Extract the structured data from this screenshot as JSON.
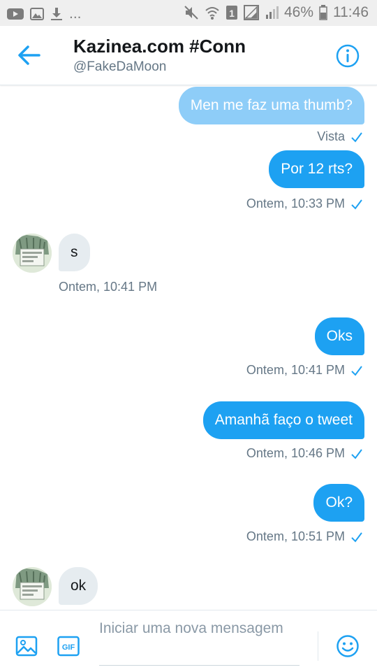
{
  "status_bar": {
    "left_more": "...",
    "battery_percent": "46%",
    "time": "11:46",
    "sim_slot": "1"
  },
  "header": {
    "title": "Kazinea.com #Conn",
    "handle": "@FakeDaMoon"
  },
  "messages": [
    {
      "direction": "sent",
      "text": "Men me faz uma thumb?",
      "meta": "Vista"
    },
    {
      "direction": "sent",
      "text": "Por 12 rts?",
      "meta": "Ontem, 10:33 PM"
    },
    {
      "direction": "received",
      "text": "s",
      "meta": "Ontem, 10:41 PM"
    },
    {
      "direction": "sent",
      "text": "Oks",
      "meta": "Ontem, 10:41 PM"
    },
    {
      "direction": "sent",
      "text": "Amanhã faço o tweet",
      "meta": "Ontem, 10:46 PM"
    },
    {
      "direction": "sent",
      "text": "Ok?",
      "meta": "Ontem, 10:51 PM"
    },
    {
      "direction": "received",
      "text": "ok"
    }
  ],
  "composer": {
    "placeholder": "Iniciar uma nova mensagem",
    "gif_label": "GIF"
  },
  "colors": {
    "accent": "#1da1f2",
    "accent_light": "#8ecdf8",
    "received_bubble": "#e6ecf0",
    "meta_text": "#657786"
  },
  "icons": [
    "youtube-icon",
    "image-icon",
    "download-icon",
    "mute-icon",
    "wifi-icon",
    "sim-icon",
    "signal-icon",
    "battery-icon",
    "back-arrow-icon",
    "info-icon",
    "check-icon",
    "gif-icon",
    "emoji-icon"
  ]
}
